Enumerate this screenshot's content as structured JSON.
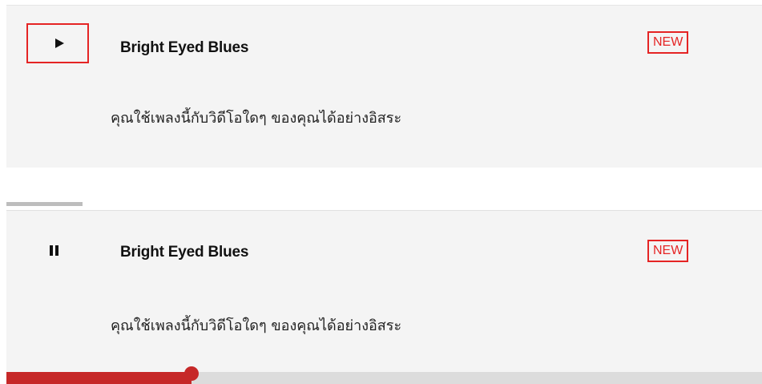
{
  "tracks": [
    {
      "state": "paused",
      "control_icon": "play-icon",
      "title": "Bright Eyed Blues",
      "badge": "NEW",
      "description": "คุณใช้เพลงนี้กับวิดีโอใดๆ ของคุณได้อย่างอิสระ"
    },
    {
      "state": "playing",
      "control_icon": "pause-icon",
      "title": "Bright Eyed Blues",
      "badge": "NEW",
      "description": "คุณใช้เพลงนี้กับวิดีโอใดๆ ของคุณได้อย่างอิสระ",
      "progress_fraction": 0.245
    }
  ],
  "colors": {
    "accent": "#e52424",
    "progress": "#c62828",
    "card_bg": "#f4f4f4"
  }
}
